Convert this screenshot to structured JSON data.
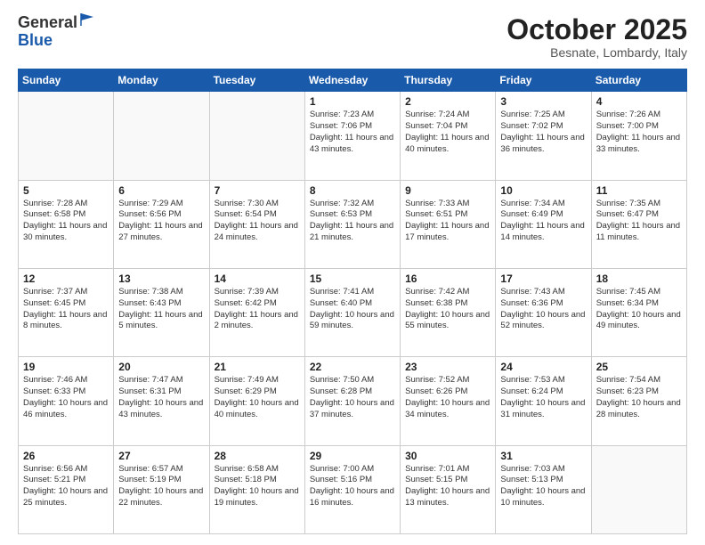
{
  "header": {
    "logo_line1": "General",
    "logo_line2": "Blue",
    "month_title": "October 2025",
    "location": "Besnate, Lombardy, Italy"
  },
  "weekdays": [
    "Sunday",
    "Monday",
    "Tuesday",
    "Wednesday",
    "Thursday",
    "Friday",
    "Saturday"
  ],
  "weeks": [
    [
      {
        "day": "",
        "info": ""
      },
      {
        "day": "",
        "info": ""
      },
      {
        "day": "",
        "info": ""
      },
      {
        "day": "1",
        "info": "Sunrise: 7:23 AM\nSunset: 7:06 PM\nDaylight: 11 hours and 43 minutes."
      },
      {
        "day": "2",
        "info": "Sunrise: 7:24 AM\nSunset: 7:04 PM\nDaylight: 11 hours and 40 minutes."
      },
      {
        "day": "3",
        "info": "Sunrise: 7:25 AM\nSunset: 7:02 PM\nDaylight: 11 hours and 36 minutes."
      },
      {
        "day": "4",
        "info": "Sunrise: 7:26 AM\nSunset: 7:00 PM\nDaylight: 11 hours and 33 minutes."
      }
    ],
    [
      {
        "day": "5",
        "info": "Sunrise: 7:28 AM\nSunset: 6:58 PM\nDaylight: 11 hours and 30 minutes."
      },
      {
        "day": "6",
        "info": "Sunrise: 7:29 AM\nSunset: 6:56 PM\nDaylight: 11 hours and 27 minutes."
      },
      {
        "day": "7",
        "info": "Sunrise: 7:30 AM\nSunset: 6:54 PM\nDaylight: 11 hours and 24 minutes."
      },
      {
        "day": "8",
        "info": "Sunrise: 7:32 AM\nSunset: 6:53 PM\nDaylight: 11 hours and 21 minutes."
      },
      {
        "day": "9",
        "info": "Sunrise: 7:33 AM\nSunset: 6:51 PM\nDaylight: 11 hours and 17 minutes."
      },
      {
        "day": "10",
        "info": "Sunrise: 7:34 AM\nSunset: 6:49 PM\nDaylight: 11 hours and 14 minutes."
      },
      {
        "day": "11",
        "info": "Sunrise: 7:35 AM\nSunset: 6:47 PM\nDaylight: 11 hours and 11 minutes."
      }
    ],
    [
      {
        "day": "12",
        "info": "Sunrise: 7:37 AM\nSunset: 6:45 PM\nDaylight: 11 hours and 8 minutes."
      },
      {
        "day": "13",
        "info": "Sunrise: 7:38 AM\nSunset: 6:43 PM\nDaylight: 11 hours and 5 minutes."
      },
      {
        "day": "14",
        "info": "Sunrise: 7:39 AM\nSunset: 6:42 PM\nDaylight: 11 hours and 2 minutes."
      },
      {
        "day": "15",
        "info": "Sunrise: 7:41 AM\nSunset: 6:40 PM\nDaylight: 10 hours and 59 minutes."
      },
      {
        "day": "16",
        "info": "Sunrise: 7:42 AM\nSunset: 6:38 PM\nDaylight: 10 hours and 55 minutes."
      },
      {
        "day": "17",
        "info": "Sunrise: 7:43 AM\nSunset: 6:36 PM\nDaylight: 10 hours and 52 minutes."
      },
      {
        "day": "18",
        "info": "Sunrise: 7:45 AM\nSunset: 6:34 PM\nDaylight: 10 hours and 49 minutes."
      }
    ],
    [
      {
        "day": "19",
        "info": "Sunrise: 7:46 AM\nSunset: 6:33 PM\nDaylight: 10 hours and 46 minutes."
      },
      {
        "day": "20",
        "info": "Sunrise: 7:47 AM\nSunset: 6:31 PM\nDaylight: 10 hours and 43 minutes."
      },
      {
        "day": "21",
        "info": "Sunrise: 7:49 AM\nSunset: 6:29 PM\nDaylight: 10 hours and 40 minutes."
      },
      {
        "day": "22",
        "info": "Sunrise: 7:50 AM\nSunset: 6:28 PM\nDaylight: 10 hours and 37 minutes."
      },
      {
        "day": "23",
        "info": "Sunrise: 7:52 AM\nSunset: 6:26 PM\nDaylight: 10 hours and 34 minutes."
      },
      {
        "day": "24",
        "info": "Sunrise: 7:53 AM\nSunset: 6:24 PM\nDaylight: 10 hours and 31 minutes."
      },
      {
        "day": "25",
        "info": "Sunrise: 7:54 AM\nSunset: 6:23 PM\nDaylight: 10 hours and 28 minutes."
      }
    ],
    [
      {
        "day": "26",
        "info": "Sunrise: 6:56 AM\nSunset: 5:21 PM\nDaylight: 10 hours and 25 minutes."
      },
      {
        "day": "27",
        "info": "Sunrise: 6:57 AM\nSunset: 5:19 PM\nDaylight: 10 hours and 22 minutes."
      },
      {
        "day": "28",
        "info": "Sunrise: 6:58 AM\nSunset: 5:18 PM\nDaylight: 10 hours and 19 minutes."
      },
      {
        "day": "29",
        "info": "Sunrise: 7:00 AM\nSunset: 5:16 PM\nDaylight: 10 hours and 16 minutes."
      },
      {
        "day": "30",
        "info": "Sunrise: 7:01 AM\nSunset: 5:15 PM\nDaylight: 10 hours and 13 minutes."
      },
      {
        "day": "31",
        "info": "Sunrise: 7:03 AM\nSunset: 5:13 PM\nDaylight: 10 hours and 10 minutes."
      },
      {
        "day": "",
        "info": ""
      }
    ]
  ]
}
